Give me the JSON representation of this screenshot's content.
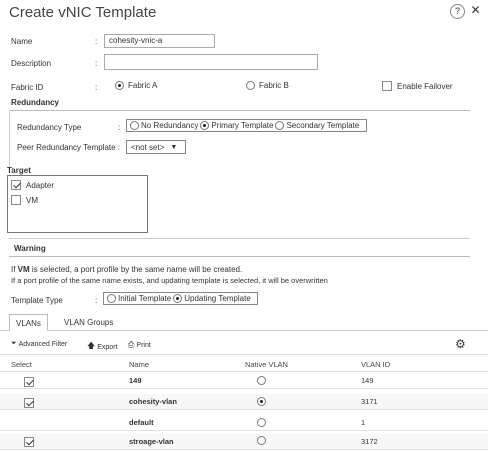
{
  "dialog": {
    "title": "Create vNIC Template",
    "help_icon": "question-icon",
    "close_icon": "close-icon"
  },
  "form": {
    "name_label": "Name",
    "name_value": "cohesity-vnic-a",
    "description_label": "Description",
    "description_value": "",
    "fabric_label": "Fabric ID",
    "fabric_a_label": "Fabric A",
    "fabric_b_label": "Fabric B",
    "fabric_selected": "Fabric A",
    "enable_failover_label": "Enable Failover",
    "colon": ":"
  },
  "redundancy": {
    "header": "Redundancy",
    "type_label": "Redundancy Type",
    "options": [
      "No Redundancy",
      "Primary Template",
      "Secondary Template"
    ],
    "selected": "Primary Template",
    "peer_label": "Peer Redundancy Template :",
    "peer_value": "<not set>"
  },
  "target": {
    "header": "Target",
    "items": [
      {
        "label": "Adapter",
        "checked": true
      },
      {
        "label": "VM",
        "checked": false
      }
    ]
  },
  "warning": {
    "header": "Warning",
    "line1_prefix": "If ",
    "line1_bold": "VM",
    "line1_suffix": " is selected, a port profile by the same name will be created.",
    "line2": "If a port profile of the same name exists, and updating template is selected, it will be overwritten"
  },
  "template_type": {
    "label": "Template Type",
    "options": [
      "Initial Template",
      "Updating Template"
    ],
    "selected": "Updating Template"
  },
  "tabs": [
    {
      "label": "VLANs",
      "active": true
    },
    {
      "label": "VLAN Groups",
      "active": false
    }
  ],
  "toolbar": {
    "advanced_filter": "Advanced Filter",
    "export": "Export",
    "print": "Print",
    "filter_icon": "filter-icon",
    "export_icon": "export-icon",
    "print_icon": "print-icon",
    "settings_icon": "gear-icon"
  },
  "table": {
    "columns": [
      "Select",
      "Name",
      "Native VLAN",
      "VLAN ID"
    ],
    "rows": [
      {
        "selected": true,
        "name": "149",
        "native": false,
        "vlan_id": "149"
      },
      {
        "selected": true,
        "name": "cohesity-vlan",
        "native": true,
        "vlan_id": "3171"
      },
      {
        "selected": false,
        "name": "default",
        "native": false,
        "vlan_id": "1"
      },
      {
        "selected": true,
        "name": "stroage-vlan",
        "native": false,
        "vlan_id": "3172"
      }
    ]
  }
}
